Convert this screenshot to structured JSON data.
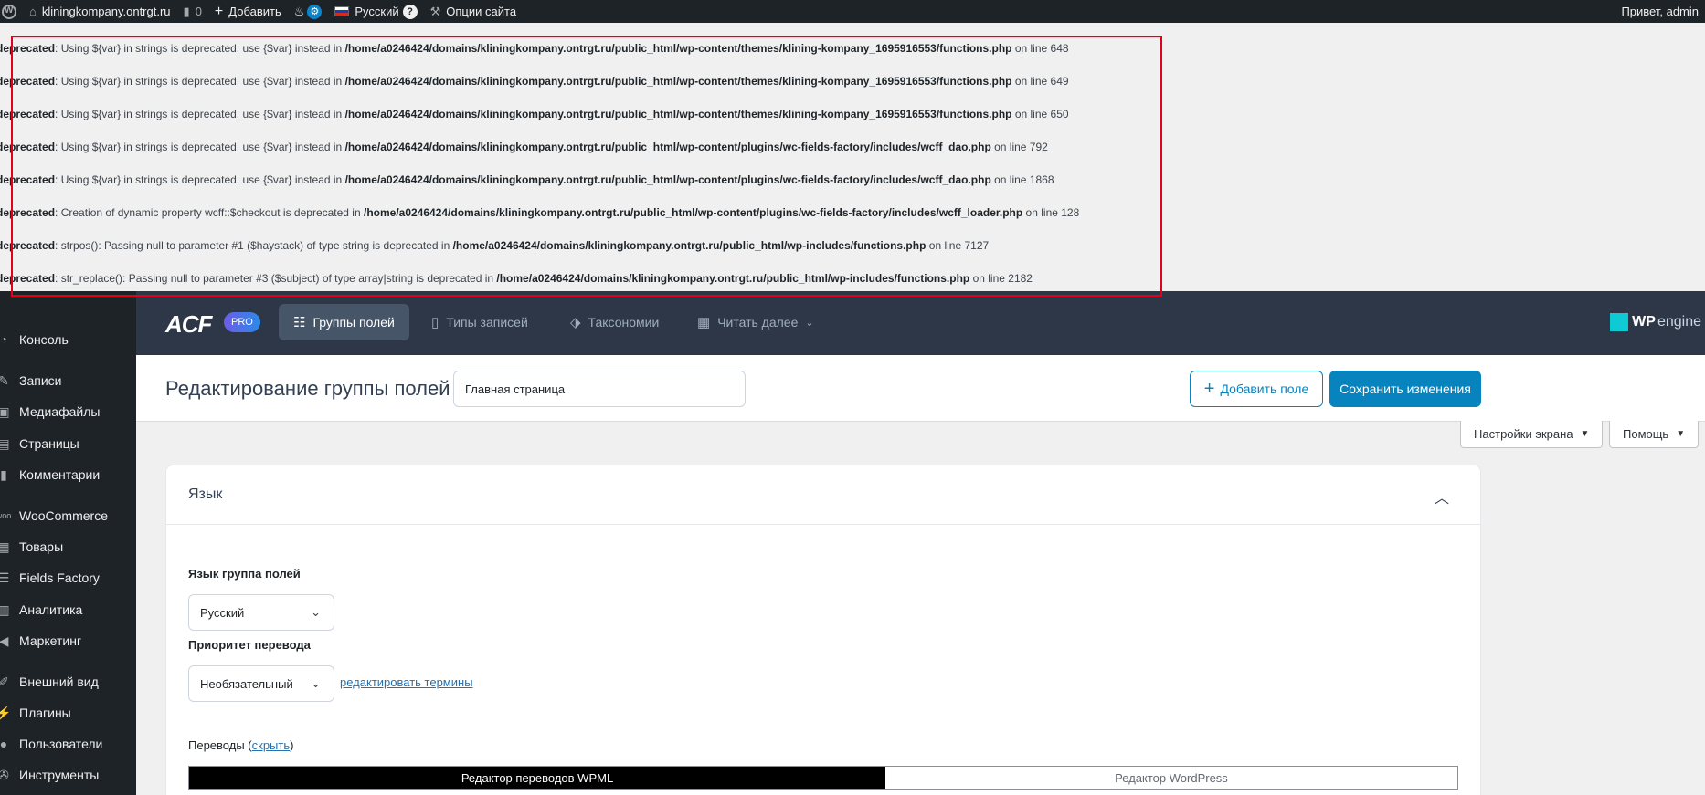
{
  "admin_bar": {
    "site_name": "kliningkompany.ontrgt.ru",
    "comments_count": "0",
    "add_label": "Добавить",
    "language": "Русский",
    "site_options": "Опции сайта",
    "greeting": "Привет, admin"
  },
  "notices": [
    {
      "level": "deprecated",
      "message": ": Using ${var} in strings is deprecated, use {$var} instead in ",
      "path": "/home/a0246424/domains/kliningkompany.ontrgt.ru/public_html/wp-content/themes/klining-kompany_1695916553/functions.php",
      "suffix": " on line 648"
    },
    {
      "level": "deprecated",
      "message": ": Using ${var} in strings is deprecated, use {$var} instead in ",
      "path": "/home/a0246424/domains/kliningkompany.ontrgt.ru/public_html/wp-content/themes/klining-kompany_1695916553/functions.php",
      "suffix": " on line 649"
    },
    {
      "level": "deprecated",
      "message": ": Using ${var} in strings is deprecated, use {$var} instead in ",
      "path": "/home/a0246424/domains/kliningkompany.ontrgt.ru/public_html/wp-content/themes/klining-kompany_1695916553/functions.php",
      "suffix": " on line 650"
    },
    {
      "level": "deprecated",
      "message": ": Using ${var} in strings is deprecated, use {$var} instead in ",
      "path": "/home/a0246424/domains/kliningkompany.ontrgt.ru/public_html/wp-content/plugins/wc-fields-factory/includes/wcff_dao.php",
      "suffix": " on line 792"
    },
    {
      "level": "deprecated",
      "message": ": Using ${var} in strings is deprecated, use {$var} instead in ",
      "path": "/home/a0246424/domains/kliningkompany.ontrgt.ru/public_html/wp-content/plugins/wc-fields-factory/includes/wcff_dao.php",
      "suffix": " on line 1868"
    },
    {
      "level": "deprecated",
      "message": ": Creation of dynamic property wcff::$checkout is deprecated in ",
      "path": "/home/a0246424/domains/kliningkompany.ontrgt.ru/public_html/wp-content/plugins/wc-fields-factory/includes/wcff_loader.php",
      "suffix": " on line 128"
    },
    {
      "level": "deprecated",
      "message": ": strpos(): Passing null to parameter #1 ($haystack) of type string is deprecated in ",
      "path": "/home/a0246424/domains/kliningkompany.ontrgt.ru/public_html/wp-includes/functions.php",
      "suffix": " on line 7127"
    },
    {
      "level": "deprecated",
      "message": ": str_replace(): Passing null to parameter #3 ($subject) of type array|string is deprecated in ",
      "path": "/home/a0246424/domains/kliningkompany.ontrgt.ru/public_html/wp-includes/functions.php",
      "suffix": " on line 2182"
    }
  ],
  "sidebar": {
    "items": [
      {
        "label": "Консоль",
        "icon": "gauge-icon"
      },
      {
        "label": "Записи",
        "icon": "pin-icon"
      },
      {
        "label": "Медиафайлы",
        "icon": "media-icon"
      },
      {
        "label": "Страницы",
        "icon": "pages-icon"
      },
      {
        "label": "Комментарии",
        "icon": "comment-icon"
      },
      {
        "label": "WooCommerce",
        "icon": "woo-icon"
      },
      {
        "label": "Товары",
        "icon": "box-icon"
      },
      {
        "label": "Fields Factory",
        "icon": "fields-icon"
      },
      {
        "label": "Аналитика",
        "icon": "chart-icon"
      },
      {
        "label": "Маркетинг",
        "icon": "megaphone-icon"
      },
      {
        "label": "Внешний вид",
        "icon": "brush-icon"
      },
      {
        "label": "Плагины",
        "icon": "plug-icon"
      },
      {
        "label": "Пользователи",
        "icon": "user-icon"
      },
      {
        "label": "Инструменты",
        "icon": "wrench-icon"
      }
    ]
  },
  "acf_header": {
    "logo": "ACF",
    "pro": "PRO",
    "tabs": [
      {
        "label": "Группы полей",
        "active": true
      },
      {
        "label": "Типы записей",
        "active": false
      },
      {
        "label": "Таксономии",
        "active": false
      },
      {
        "label": "Читать далее",
        "active": false
      }
    ],
    "wpengine_bold": "WP",
    "wpengine_light": "engine"
  },
  "title_bar": {
    "title": "Редактирование группы полей",
    "group_name": "Главная страница",
    "add_field": "Добавить поле",
    "save": "Сохранить изменения"
  },
  "screen_options": "Настройки экрана",
  "help": "Помощь",
  "postbox": {
    "title": "Язык",
    "language_label": "Язык группа полей",
    "language_value": "Русский",
    "priority_label": "Приоритет перевода",
    "priority_value": "Необязательный",
    "edit_terms": "редактировать термины",
    "translations_label": "Переводы",
    "hide_link": "скрыть",
    "editor_wpml": "Редактор переводов WPML",
    "editor_wp": "Редактор WordPress"
  },
  "colors": {
    "admin_bar": "#1d2327",
    "acf_header": "#2d3748",
    "primary": "#0783be",
    "notice_box": "#e3001b"
  }
}
